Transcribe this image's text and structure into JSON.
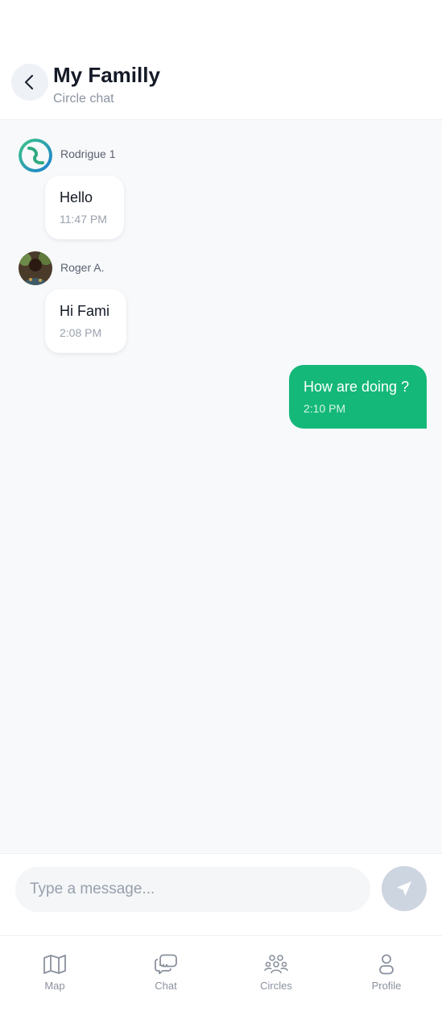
{
  "header": {
    "title": "My Familly",
    "subtitle": "Circle chat",
    "back_icon": "chevron-left-icon"
  },
  "messages": [
    {
      "direction": "incoming",
      "sender": "Rodrigue 1",
      "avatar": "app-logo-avatar",
      "text": "Hello",
      "time": "11:47 PM"
    },
    {
      "direction": "incoming",
      "sender": "Roger A.",
      "avatar": "photo-avatar",
      "text": "Hi Fami",
      "time": "2:08 PM"
    },
    {
      "direction": "outgoing",
      "text": "How are doing ?",
      "time": "2:10 PM"
    }
  ],
  "composer": {
    "placeholder": "Type a message...",
    "value": "",
    "send_icon": "send-icon"
  },
  "nav": {
    "items": [
      {
        "label": "Map",
        "icon": "map-icon"
      },
      {
        "label": "Chat",
        "icon": "chat-icon"
      },
      {
        "label": "Circles",
        "icon": "circles-icon"
      },
      {
        "label": "Profile",
        "icon": "profile-icon"
      }
    ]
  },
  "colors": {
    "accent_green": "#14b879",
    "chat_background": "#f7f9fb",
    "send_button": "#cdd5e0"
  }
}
